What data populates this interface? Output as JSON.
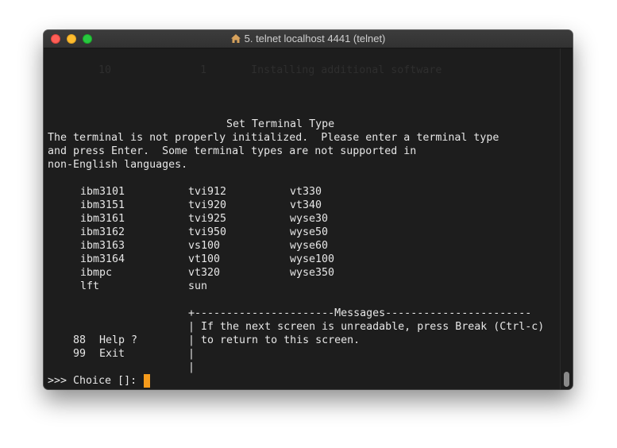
{
  "window": {
    "title": "5. telnet localhost 4441 (telnet)"
  },
  "terminal": {
    "ghost_line": "        10              1       Installing additional software",
    "header": "Set Terminal Type",
    "intro": [
      "The terminal is not properly initialized.  Please enter a terminal type",
      "and press Enter.  Some terminal types are not supported in",
      "non-English languages."
    ],
    "terminal_types": {
      "col1": [
        "ibm3101",
        "ibm3151",
        "ibm3161",
        "ibm3162",
        "ibm3163",
        "ibm3164",
        "ibmpc",
        "lft"
      ],
      "col2": [
        "tvi912",
        "tvi920",
        "tvi925",
        "tvi950",
        "vs100",
        "vt100",
        "vt320",
        "sun"
      ],
      "col3": [
        "vt330",
        "vt340",
        "wyse30",
        "wyse50",
        "wyse60",
        "wyse100",
        "wyse350"
      ]
    },
    "messages": {
      "border_top": "+----------------------Messages-----------------------",
      "line1": "| If the next screen is unreadable, press Break (Ctrl-c)",
      "line2": "| to return to this screen.",
      "line3": "|",
      "line4": "|"
    },
    "options": [
      {
        "key": "88",
        "label": "Help ?"
      },
      {
        "key": "99",
        "label": "Exit"
      }
    ],
    "prompt": ">>> Choice []: "
  },
  "colors": {
    "cursor": "#f59b1c",
    "background": "#1d1d1d",
    "text": "#e6e6e6"
  }
}
